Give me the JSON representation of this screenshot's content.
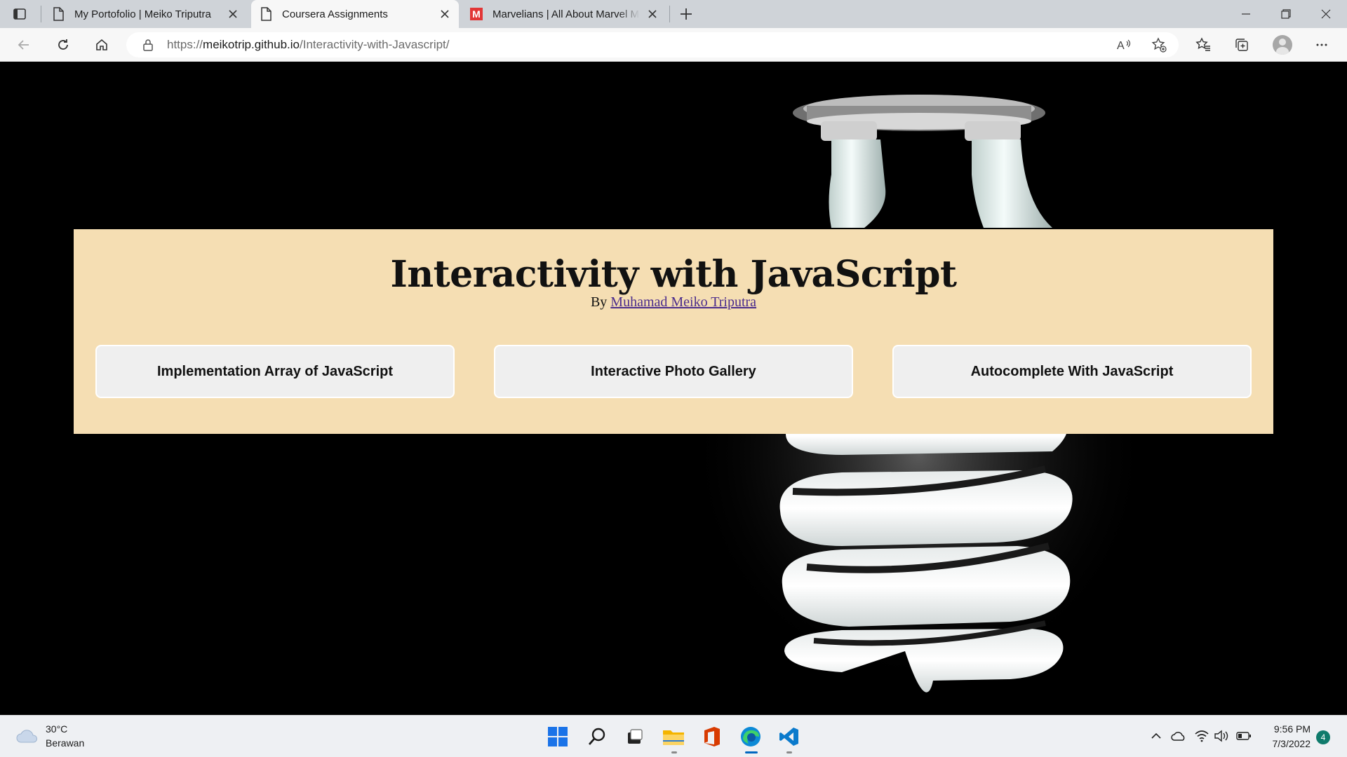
{
  "browser": {
    "tabs": [
      {
        "title": "My Portofolio | Meiko Triputra",
        "icon": "page-icon"
      },
      {
        "title": "Coursera Assignments",
        "icon": "page-icon",
        "active": true
      },
      {
        "title": "Marvelians | All About Marvel Movies",
        "icon": "marvel-m-icon",
        "favicon_letter": "M"
      }
    ],
    "address": {
      "prefix": "https://",
      "host": "meikotrip.github.io",
      "path": "/Interactivity-with-Javascript/"
    }
  },
  "page": {
    "title": "Interactivity with JavaScript",
    "byline_prefix": "By",
    "author": "Muhamad Meiko Triputra",
    "buttons": [
      {
        "label": "Implementation Array of JavaScript"
      },
      {
        "label": "Interactive Photo Gallery"
      },
      {
        "label": "Autocomplete With JavaScript"
      }
    ],
    "colors": {
      "panel": "#f5deb3",
      "background": "#000000",
      "button": "#efefef"
    }
  },
  "taskbar": {
    "weather": {
      "temp": "30°C",
      "desc": "Berawan"
    },
    "apps": [
      "start-icon",
      "search-icon",
      "task-view-icon",
      "file-explorer-icon",
      "office-icon",
      "edge-icon",
      "vscode-icon"
    ],
    "clock": {
      "time": "9:56 PM",
      "date": "7/3/2022"
    },
    "notification_count": "4"
  }
}
